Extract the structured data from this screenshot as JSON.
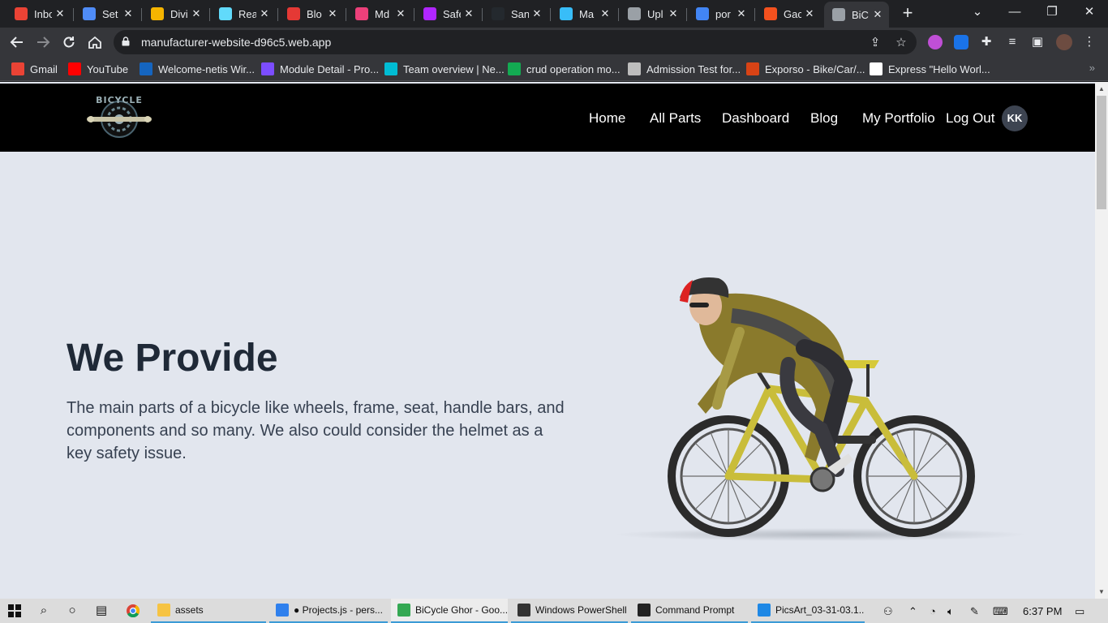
{
  "tabs": [
    {
      "title": "Inbox",
      "icon": "gmail-icon",
      "color": "#ea4335"
    },
    {
      "title": "Set",
      "icon": "flag-icon",
      "color": "#4f8cf7"
    },
    {
      "title": "Divi",
      "icon": "sun-icon",
      "color": "#f5b400"
    },
    {
      "title": "Rea",
      "icon": "react-icon",
      "color": "#61dafb"
    },
    {
      "title": "Blo",
      "icon": "b-icon",
      "color": "#e53935"
    },
    {
      "title": "Md",
      "icon": "palette-icon",
      "color": "#ec407a"
    },
    {
      "title": "Safe",
      "icon": "s-icon",
      "color": "#b026ff"
    },
    {
      "title": "San",
      "icon": "github-icon",
      "color": "#24292e"
    },
    {
      "title": "Ma",
      "icon": "tailwind-icon",
      "color": "#38bdf8"
    },
    {
      "title": "Upl",
      "icon": "layers-icon",
      "color": "#9aa0a6"
    },
    {
      "title": "por",
      "icon": "google-icon",
      "color": "#4285f4"
    },
    {
      "title": "Gac",
      "icon": "flame-icon",
      "color": "#f4511e"
    },
    {
      "title": "BiC",
      "icon": "arrow-icon",
      "color": "#9aa0a6",
      "active": true
    }
  ],
  "address_bar": {
    "url": "manufacturer-website-d96c5.web.app"
  },
  "bookmarks": [
    {
      "label": "Gmail",
      "icon": "gmail-icon",
      "color": "#ea4335"
    },
    {
      "label": "YouTube",
      "icon": "youtube-icon",
      "color": "#ff0000"
    },
    {
      "label": "Welcome-netis Wir...",
      "icon": "n-icon",
      "color": "#1565c0"
    },
    {
      "label": "Module Detail - Pro...",
      "icon": "ph-icon",
      "color": "#7c4dff"
    },
    {
      "label": "Team overview | Ne...",
      "icon": "diamond-icon",
      "color": "#00bcd4"
    },
    {
      "label": "crud operation mo...",
      "icon": "mongodb-icon",
      "color": "#13aa52"
    },
    {
      "label": "Admission Test for...",
      "icon": "globe-icon",
      "color": "#bdbdbd"
    },
    {
      "label": "Exporso - Bike/Car/...",
      "icon": "e-icon",
      "color": "#d84315"
    },
    {
      "label": "Express \"Hello Worl...",
      "icon": "ex-icon",
      "color": "#ffffff"
    }
  ],
  "bookmarks_more": "»",
  "site": {
    "logo_text": "BICYCLE",
    "nav": [
      "Home",
      "All Parts",
      "Dashboard",
      "Blog",
      "My Portfolio",
      "Log Out"
    ],
    "avatar": "KK",
    "hero": {
      "title": "We Provide",
      "text": "The main parts of a bicycle like wheels, frame, seat, handle bars, and components and so many. We also could consider the helmet as a key safety issue."
    }
  },
  "taskbar": {
    "apps": [
      {
        "label": "assets",
        "icon": "folder-icon",
        "color": "#f6c342"
      },
      {
        "label": "● Projects.js - pers...",
        "icon": "vscode-icon",
        "color": "#2f80ed"
      },
      {
        "label": "BiCycle Ghor - Goo...",
        "icon": "chrome-icon",
        "color": "#34a853"
      },
      {
        "label": "Windows PowerShell",
        "icon": "terminal-icon",
        "color": "#333333"
      },
      {
        "label": "Command Prompt",
        "icon": "cmd-icon",
        "color": "#222222"
      },
      {
        "label": "PicsArt_03-31-03.1...",
        "icon": "image-icon",
        "color": "#1e88e5"
      }
    ],
    "clock": "6:37 PM"
  }
}
